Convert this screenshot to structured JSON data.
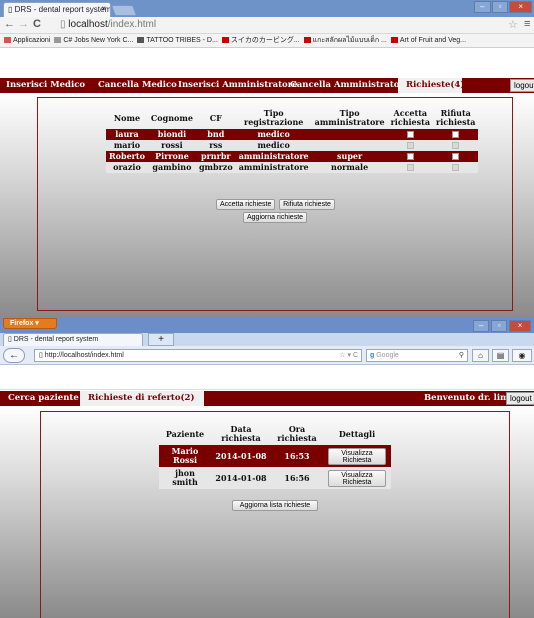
{
  "chrome": {
    "tab_title": "DRS - dental report system",
    "tab_close": "×",
    "url_host": "localhost",
    "url_path": "/index.html",
    "bookmarks": [
      {
        "label": "Applicazioni",
        "color": "#d9534f"
      },
      {
        "label": "C# Jobs New York C...",
        "color": "#999999"
      },
      {
        "label": "TATTOO TRIBES - D...",
        "color": "#555555"
      },
      {
        "label": "スイカのカービング...",
        "color": "#cc0000"
      },
      {
        "label": "แกะสลักผลไม้แบบเด็ก ...",
        "color": "#cc0000"
      },
      {
        "label": "Art of Fruit and Veg...",
        "color": "#cc0000"
      }
    ],
    "app": {
      "nav": [
        "Inserisci Medico",
        "Cancella Medico",
        "Inserisci Amministratore",
        "Cancella Amministratore"
      ],
      "active_tab": "Richieste(4)",
      "logout": "logout",
      "table": {
        "headers": [
          "Nome",
          "Cognome",
          "CF",
          "Tipo registrazione",
          "Tipo amministratore",
          "Accetta richiesta",
          "Rifiuta richiesta"
        ],
        "rows": [
          {
            "nome": "laura",
            "cognome": "biondi",
            "cf": "bnd",
            "tipo_reg": "medico",
            "tipo_amm": "",
            "style": "dark"
          },
          {
            "nome": "mario",
            "cognome": "rossi",
            "cf": "rss",
            "tipo_reg": "medico",
            "tipo_amm": "",
            "style": "light"
          },
          {
            "nome": "Roberto",
            "cognome": "Pirrone",
            "cf": "prnrbr",
            "tipo_reg": "amministratore",
            "tipo_amm": "super",
            "style": "dark"
          },
          {
            "nome": "orazio",
            "cognome": "gambino",
            "cf": "gmbrzo",
            "tipo_reg": "amministratore",
            "tipo_amm": "normale",
            "style": "light"
          }
        ]
      },
      "accept_button": "Accetta richieste",
      "reject_button": "Rifiuta richieste",
      "refresh_button": "Aggiorna richieste"
    }
  },
  "firefox": {
    "menu_button": "Firefox",
    "tab_title": "DRS - dental report system",
    "new_tab": "+",
    "url": "http://localhost/index.html",
    "search_engine": "Google",
    "app": {
      "nav": [
        "Cerca paziente"
      ],
      "active_tab": "Richieste di referto(2)",
      "welcome": "Benvenuto dr. lima",
      "logout": "logout",
      "table": {
        "headers": [
          "Paziente",
          "Data richiesta",
          "Ora richiesta",
          "Dettagli"
        ],
        "rows": [
          {
            "paziente": "Mario Rossi",
            "data": "2014-01-08",
            "ora": "16:53",
            "dettagli": "Visualizza Richiesta",
            "style": "dark"
          },
          {
            "paziente": "jhon smith",
            "data": "2014-01-08",
            "ora": "16:56",
            "dettagli": "Visualizza Richiesta",
            "style": "light"
          }
        ]
      },
      "refresh_button": "Aggiorna lista richieste"
    }
  },
  "colors": {
    "brand": "#7a0000",
    "row_dark": "#7a0000",
    "row_light": "#e6e6e6",
    "firefox_orange": "#e67b1c"
  }
}
